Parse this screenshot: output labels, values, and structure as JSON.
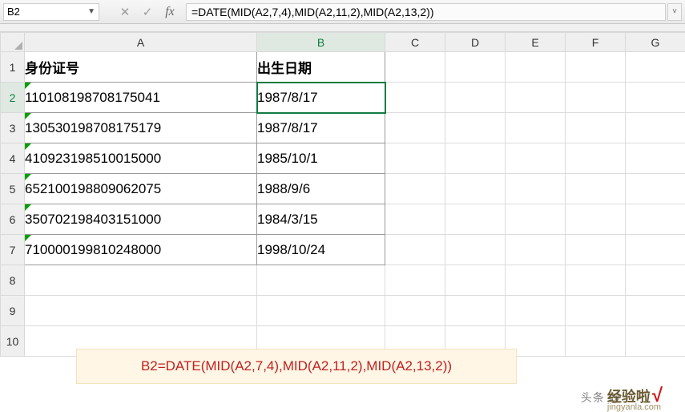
{
  "namebox": "B2",
  "formula": "=DATE(MID(A2,7,4),MID(A2,11,2),MID(A2,13,2))",
  "columns": [
    "A",
    "B",
    "C",
    "D",
    "E",
    "F",
    "G"
  ],
  "row_numbers": [
    "1",
    "2",
    "3",
    "4",
    "5",
    "6",
    "7",
    "8",
    "9",
    "10"
  ],
  "header": {
    "A": "身份证号",
    "B": "出生日期"
  },
  "rows": [
    {
      "id": "110108198708175041",
      "dob": "1987/8/17"
    },
    {
      "id": "130530198708175179",
      "dob": "1987/8/17"
    },
    {
      "id": "410923198510015000",
      "dob": "1985/10/1"
    },
    {
      "id": "652100198809062075",
      "dob": "1988/9/6"
    },
    {
      "id": "350702198403151000",
      "dob": "1984/3/15"
    },
    {
      "id": "710000199810248000",
      "dob": "1998/10/24"
    }
  ],
  "annotation": "B2=DATE(MID(A2,7,4),MID(A2,11,2),MID(A2,13,2))",
  "watermark1": "头条 @",
  "watermark2": "经验啦",
  "watermark2_sub": "jingyanla.com"
}
